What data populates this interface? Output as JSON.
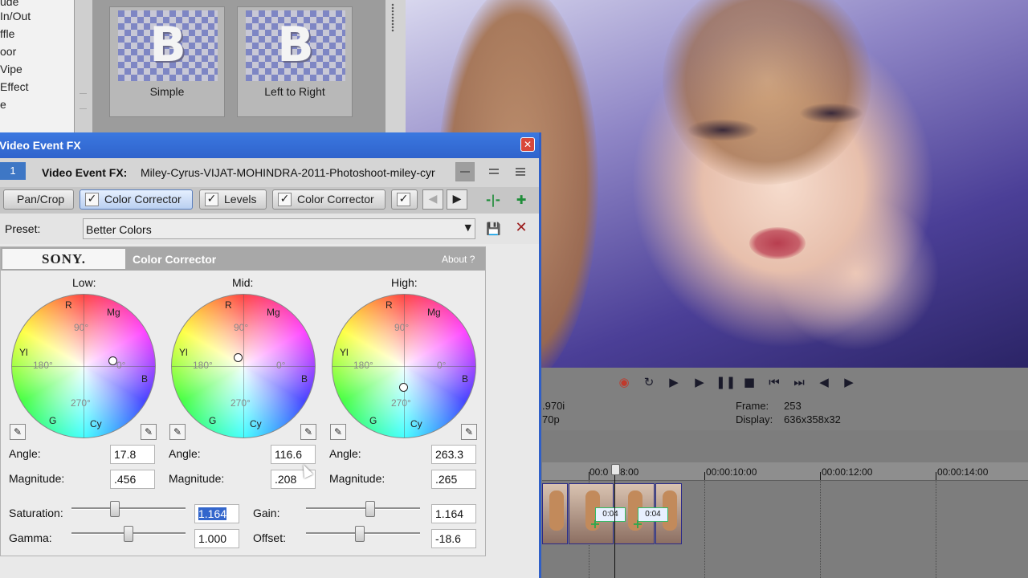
{
  "left_list": [
    "ude",
    "In/Out",
    "ffle",
    "oor",
    "Vipe",
    "Effect",
    "e"
  ],
  "transitions": [
    {
      "glyph": "B",
      "label": "Simple"
    },
    {
      "glyph": "B",
      "label": "Left to Right"
    }
  ],
  "fx_window": {
    "title": "Video Event FX",
    "event_number": "1",
    "event_label": "Video Event FX:",
    "event_file": "Miley-Cyrus-VIJAT-MOHINDRA-2011-Photoshoot-miley-cyr",
    "chain": [
      "Pan/Crop",
      "Color Corrector",
      "Levels",
      "Color Corrector"
    ],
    "preset_label": "Preset:",
    "preset_value": "Better Colors"
  },
  "color_corrector": {
    "brand": "SONY.",
    "title": "Color Corrector",
    "about": "About  ?",
    "wheel_labels": {
      "r": "R",
      "mg": "Mg",
      "b": "B",
      "cy": "Cy",
      "g": "G",
      "yl": "Yl",
      "deg0": "0°",
      "deg90": "90°",
      "deg180": "180°",
      "deg270": "270°"
    },
    "wheels": [
      {
        "name": "Low:",
        "angle_label": "Angle:",
        "angle": "17.8",
        "magnitude_label": "Magnitude:",
        "magnitude": ".456"
      },
      {
        "name": "Mid:",
        "angle_label": "Angle:",
        "angle": "116.6",
        "magnitude_label": "Magnitude:",
        "magnitude": ".208"
      },
      {
        "name": "High:",
        "angle_label": "Angle:",
        "angle": "263.3",
        "magnitude_label": "Magnitude:",
        "magnitude": ".265"
      }
    ],
    "saturation": {
      "label": "Saturation:",
      "value": "1.164",
      "level": 0.38
    },
    "gamma": {
      "label": "Gamma:",
      "value": "1.000",
      "level": 0.5
    },
    "gain": {
      "label": "Gain:",
      "value": "1.164",
      "level": 0.56
    },
    "offset": {
      "label": "Offset:",
      "value": "-18.6",
      "level": 0.47
    }
  },
  "preview_info": {
    "left1": ".970i",
    "left2": "70p",
    "frame_label": "Frame:",
    "frame_value": "253",
    "display_label": "Display:",
    "display_value": "636x358x32"
  },
  "timeline": {
    "ruler": [
      "00:0",
      "8:00",
      "00:00:10:00",
      "00:00:12:00",
      "00:00:14:00"
    ],
    "crossfade_labels": [
      "0:04",
      "0:04"
    ]
  }
}
